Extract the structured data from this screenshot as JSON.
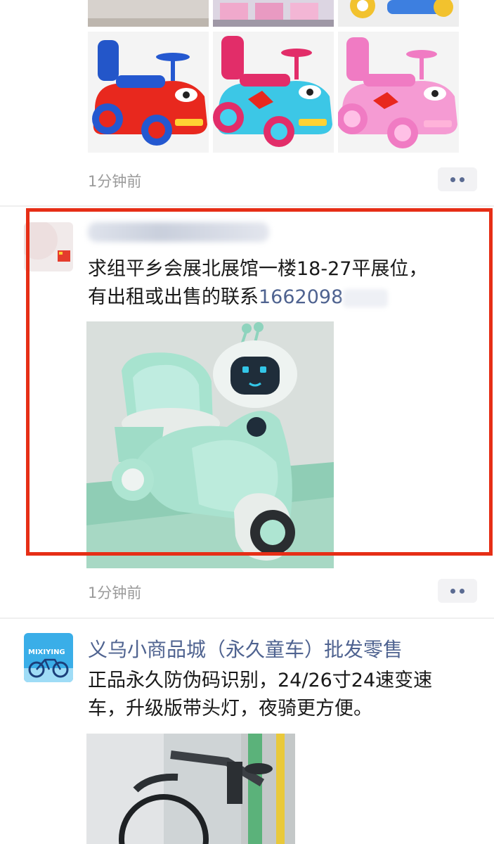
{
  "posts": [
    {
      "timestamp": "1分钟前",
      "images": [
        "red-ride-on-car",
        "blue-ride-on-car",
        "pink-ride-on-car"
      ]
    },
    {
      "author": "",
      "text_line1": "求组平乡会展北展馆一楼18-27平展位，",
      "text_line2_prefix": "有出租或出售的联系",
      "phone": "1662098",
      "timestamp": "1分钟前",
      "image": "mint-green-electric-trike"
    },
    {
      "author": "义乌小商品城（永久童车）批发零售",
      "text_line1": "正品永久防伪码识别，24/26寸24速变速",
      "text_line2": "车，升级版带头灯，夜骑更方便。",
      "avatar_text": "MIXIYING",
      "image": "grey-bicycle"
    }
  ],
  "colors": {
    "link": "#4f6390",
    "highlight": "#e62e16",
    "timestamp": "#9a9a9a"
  }
}
